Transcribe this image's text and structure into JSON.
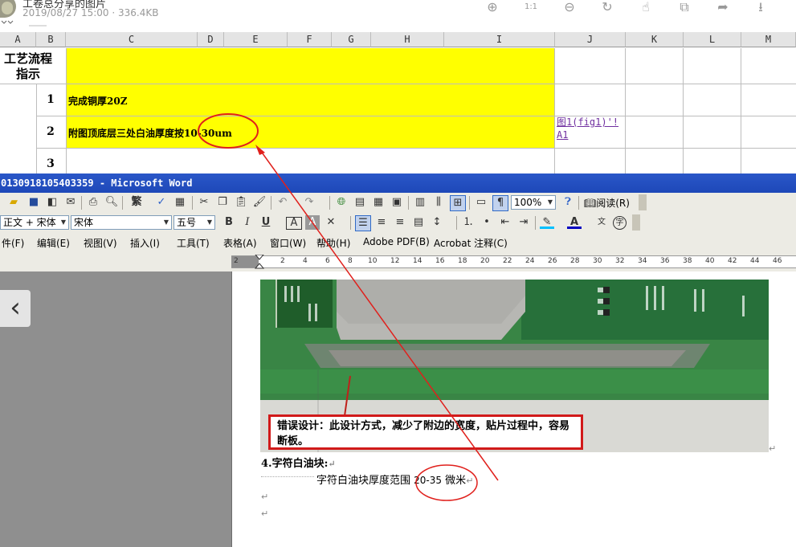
{
  "viewer": {
    "title": "工卷总分享的图片",
    "meta": "2019/08/27 15:00 · 336.4KB",
    "tools": [
      "zoom-in-icon",
      "actual-size-icon",
      "zoom-out-icon",
      "rotate-icon",
      "hand-icon",
      "picture-icon",
      "share-icon",
      "download-icon"
    ],
    "tool_glyphs": [
      "⊕",
      "1:1",
      "⊖",
      "↻",
      "☝",
      "⧉",
      "➦",
      "⭳"
    ],
    "back_glyph": "‹"
  },
  "sheet": {
    "columns": [
      "A",
      "B",
      "C",
      "D",
      "E",
      "F",
      "G",
      "H",
      "I",
      "J",
      "K",
      "L",
      "M"
    ],
    "a_label": "工艺流程指示",
    "rows": [
      {
        "num": "1",
        "text": "完成铜厚20Z"
      },
      {
        "num": "2",
        "text": "附图顶底层三处白油厚度按10-30um",
        "link": "图1(fig1)'!A1"
      },
      {
        "num": "3",
        "text": ""
      }
    ],
    "colors": {
      "highlight": "#ffff00",
      "link": "#7030a0",
      "annotation": "#e0201c"
    }
  },
  "word": {
    "title": "0130918105403359 - Microsoft Word",
    "zoom": "100%",
    "read_label": "阅读(R)",
    "style": "正文 + 宋体",
    "font": "宋体",
    "size": "五号",
    "menu": [
      "件(F)",
      "编辑(E)",
      "视图(V)",
      "插入(I)",
      "工具(T)",
      "表格(A)",
      "窗口(W)",
      "帮助(H)",
      "Adobe PDF(B)",
      "Acrobat 注释(C)"
    ],
    "ruler_marks": [
      "2",
      "2",
      "4",
      "6",
      "8",
      "10",
      "12",
      "14",
      "16",
      "18",
      "20",
      "22",
      "24",
      "26",
      "28",
      "30",
      "32",
      "34",
      "36",
      "38",
      "40",
      "42",
      "44",
      "46"
    ],
    "callout": "错误设计：此设计方式，减少了附边的宽度，贴片过程中，容易断板。",
    "section_heading": "4.字符白油块:",
    "body_prefix": "字符白油块厚度范围",
    "body_value": "20-35",
    "body_suffix": "微米",
    "para_mark": "↵"
  }
}
